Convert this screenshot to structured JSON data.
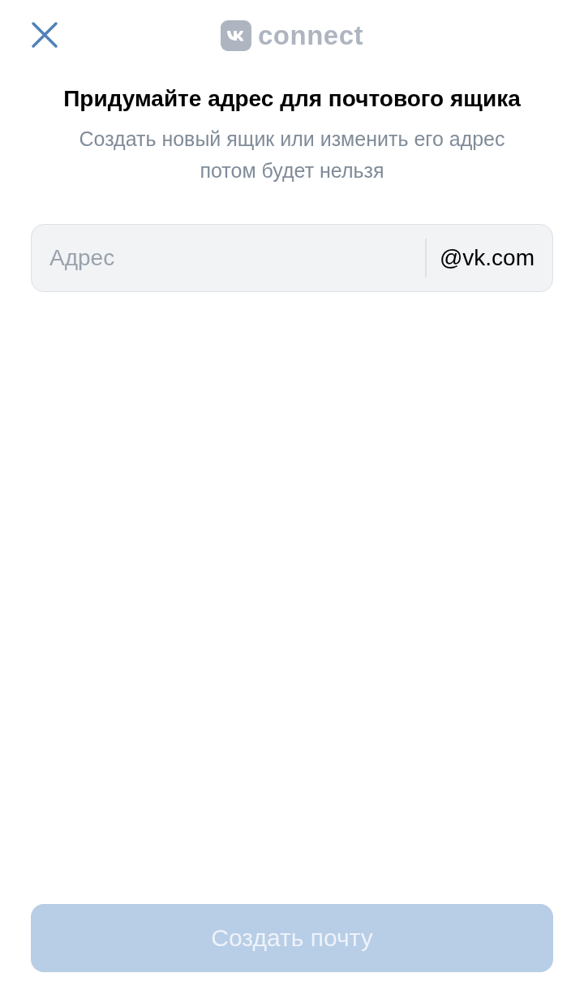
{
  "header": {
    "logo_text": "connect"
  },
  "title": "Придумайте адрес для почтового ящика",
  "subtitle": "Создать новый ящик или изменить его адрес потом будет нельзя",
  "address_field": {
    "placeholder": "Адрес",
    "suffix": "@vk.com"
  },
  "submit_button": {
    "label": "Создать почту",
    "disabled": true
  }
}
